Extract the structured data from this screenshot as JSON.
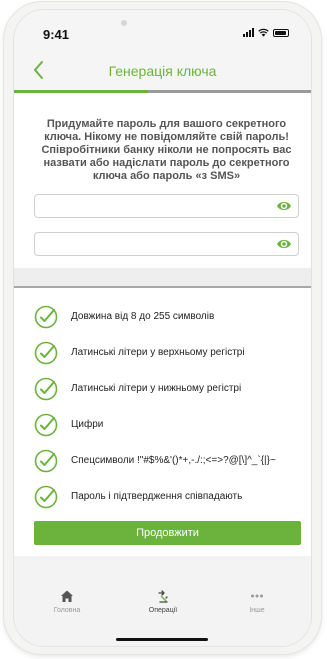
{
  "status_bar": {
    "time": "9:41"
  },
  "header": {
    "title": "Генерація ключа",
    "back_icon": "chevron-left-icon"
  },
  "progress": {
    "fraction": 0.45
  },
  "instruction": "Придумайте пароль для вашого секретного ключа. Нікому не повідомляйте свій пароль! Співробітники банку ніколи не попросять вас назвати або надіслати пароль до секретного ключа або пароль «з SMS»",
  "fields": [
    {
      "value": "",
      "placeholder": "",
      "icon": "eye-icon"
    },
    {
      "value": "",
      "placeholder": "",
      "icon": "eye-icon"
    }
  ],
  "requirements": [
    {
      "label": "Довжина від 8 до 255 символів"
    },
    {
      "label": "Латинські літери у верхньому регістрі"
    },
    {
      "label": "Латинські літери у нижньому регістрі"
    },
    {
      "label": "Цифри"
    },
    {
      "label": "Спецсимволи !\"#$%&'()*+,-./:;<=>?@[\\]^_`{|}~"
    },
    {
      "label": "Пароль і підтвердження співпадають"
    }
  ],
  "continue_label": "Продовжити",
  "tabbar": {
    "tabs": [
      {
        "label": "Головна",
        "icon": "home-icon"
      },
      {
        "label": "Операції",
        "icon": "transfer-icon"
      },
      {
        "label": "Інше",
        "icon": "more-icon"
      }
    ],
    "active_index": 1
  },
  "colors": {
    "accent": "#6cb33e",
    "divider": "#a8a8a8",
    "text": "#555555"
  }
}
